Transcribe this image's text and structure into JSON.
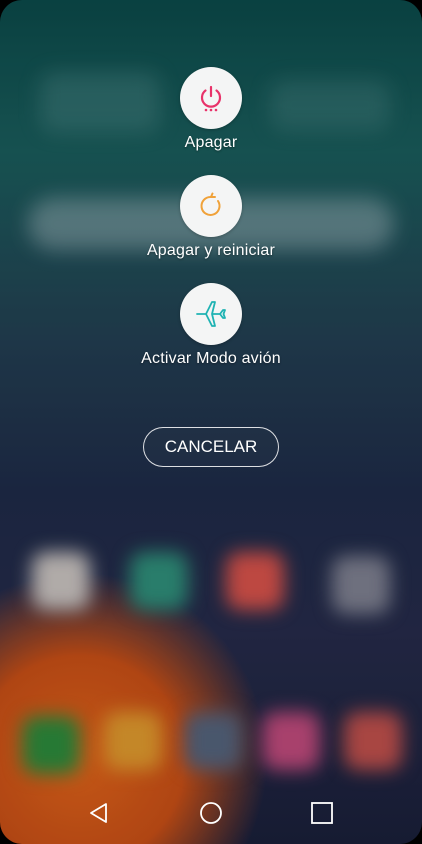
{
  "power_menu": {
    "items": [
      {
        "label": "Apagar",
        "icon": "power-icon",
        "color": "#e8336a"
      },
      {
        "label": "Apagar y reiniciar",
        "icon": "restart-icon",
        "color": "#f0a23a"
      },
      {
        "label": "Activar Modo avión",
        "icon": "airplane-icon",
        "color": "#1fb3b3"
      }
    ],
    "cancel_label": "CANCELAR"
  },
  "navigation_bar": {
    "back": "back-icon",
    "home": "home-icon",
    "recents": "recents-icon"
  }
}
